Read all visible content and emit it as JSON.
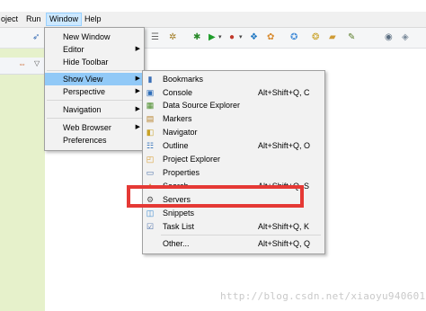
{
  "menubar": {
    "items": [
      "oject",
      "Run",
      "Window",
      "Help"
    ]
  },
  "window_menu": {
    "items": [
      "New Window",
      "Editor",
      "Hide Toolbar",
      "Show View",
      "Perspective",
      "Navigation",
      "Web Browser",
      "Preferences"
    ]
  },
  "show_view_menu": {
    "items": [
      {
        "label": "Bookmarks",
        "accel": "",
        "icon": "bookmark-icon"
      },
      {
        "label": "Console",
        "accel": "Alt+Shift+Q, C",
        "icon": "console-icon"
      },
      {
        "label": "Data Source Explorer",
        "accel": "",
        "icon": "database-icon"
      },
      {
        "label": "Markers",
        "accel": "",
        "icon": "markers-icon"
      },
      {
        "label": "Navigator",
        "accel": "",
        "icon": "navigator-icon"
      },
      {
        "label": "Outline",
        "accel": "Alt+Shift+Q, O",
        "icon": "outline-icon"
      },
      {
        "label": "Project Explorer",
        "accel": "",
        "icon": "project-explorer-icon"
      },
      {
        "label": "Properties",
        "accel": "",
        "icon": "properties-icon"
      },
      {
        "label": "Search",
        "accel": "Alt+Shift+Q, S",
        "icon": "search-icon"
      },
      {
        "label": "Servers",
        "accel": "",
        "icon": "servers-icon"
      },
      {
        "label": "Snippets",
        "accel": "",
        "icon": "snippets-icon"
      },
      {
        "label": "Task List",
        "accel": "Alt+Shift+Q, K",
        "icon": "task-list-icon"
      },
      {
        "label": "Other...",
        "accel": "Alt+Shift+Q, Q",
        "icon": ""
      }
    ]
  },
  "watermark": "http://blog.csdn.net/xiaoyu940601",
  "colors": {
    "highlight": "#91c9f7",
    "red_box": "#e53935",
    "left_panel": "#e6f1cb"
  }
}
